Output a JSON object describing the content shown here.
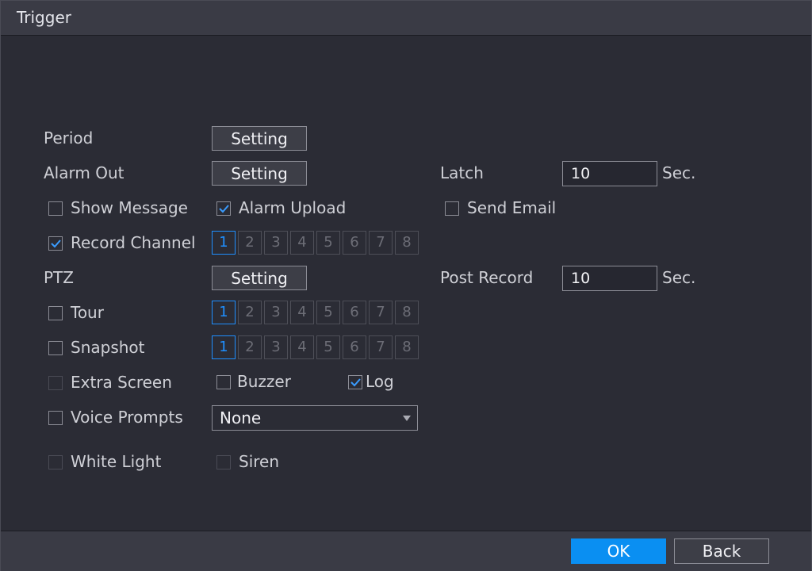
{
  "window": {
    "title": "Trigger"
  },
  "labels": {
    "period": "Period",
    "alarm_out": "Alarm Out",
    "latch": "Latch",
    "ptz": "PTZ",
    "post_record": "Post Record",
    "sec": "Sec."
  },
  "buttons": {
    "setting": "Setting",
    "ok": "OK",
    "back": "Back"
  },
  "fields": {
    "latch_value": "10",
    "post_record_value": "10"
  },
  "checkboxes": {
    "show_message": {
      "label": "Show Message",
      "checked": false
    },
    "alarm_upload": {
      "label": "Alarm Upload",
      "checked": true
    },
    "send_email": {
      "label": "Send Email",
      "checked": false
    },
    "record_channel": {
      "label": "Record Channel",
      "checked": true
    },
    "tour": {
      "label": "Tour",
      "checked": false
    },
    "snapshot": {
      "label": "Snapshot",
      "checked": false
    },
    "extra_screen": {
      "label": "Extra Screen",
      "checked": false,
      "enabled": false
    },
    "buzzer": {
      "label": "Buzzer",
      "checked": false
    },
    "log": {
      "label": "Log",
      "checked": true
    },
    "voice_prompts": {
      "label": "Voice Prompts",
      "checked": false
    },
    "white_light": {
      "label": "White Light",
      "checked": false,
      "enabled": false
    },
    "siren": {
      "label": "Siren",
      "checked": false,
      "enabled": false
    }
  },
  "channels": [
    "1",
    "2",
    "3",
    "4",
    "5",
    "6",
    "7",
    "8"
  ],
  "voice_prompts_select": {
    "value": "None"
  },
  "colors": {
    "accent": "#1f8fff",
    "ok_button": "#0a8ff2",
    "background": "#2b2c35",
    "titlebar": "#3a3b45"
  },
  "icons": {
    "checkmark": "check-icon",
    "dropdown": "chevron-down-icon"
  }
}
